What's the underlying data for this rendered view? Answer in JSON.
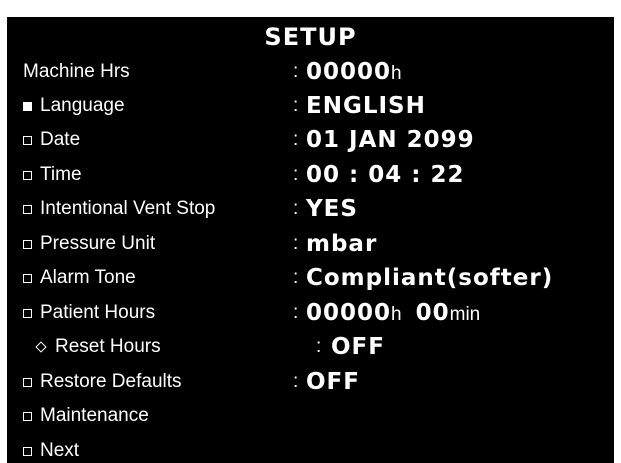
{
  "title": "SETUP",
  "separator": ":",
  "rows": [
    {
      "label": "Machine Hrs",
      "value": "00000",
      "unit": "h"
    },
    {
      "label": "Language",
      "value": "ENGLISH"
    },
    {
      "label": "Date",
      "value": "01 JAN 2099"
    },
    {
      "label": "Time",
      "value": "00 : 04 : 22"
    },
    {
      "label": "Intentional Vent Stop",
      "value": "YES"
    },
    {
      "label": "Pressure Unit",
      "value": "mbar"
    },
    {
      "label": "Alarm Tone",
      "value": "Compliant(softer)"
    },
    {
      "label": "Patient Hours",
      "value": "00000",
      "unit": "h",
      "value2": "00",
      "unit2": "min"
    },
    {
      "label": "Reset Hours",
      "value": "OFF"
    },
    {
      "label": "Restore Defaults",
      "value": "OFF"
    },
    {
      "label": "Maintenance"
    },
    {
      "label": "Next"
    }
  ]
}
